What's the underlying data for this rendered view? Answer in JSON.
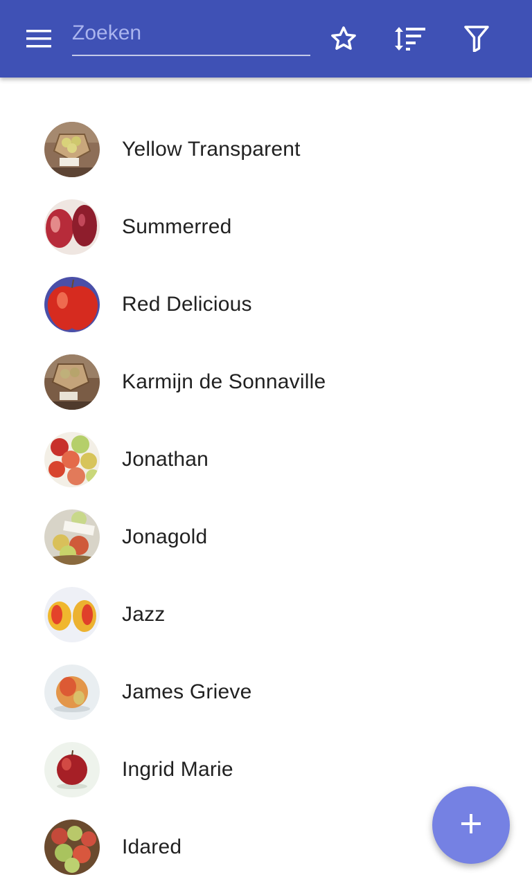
{
  "colors": {
    "appbar": "#3f51b5",
    "fab": "#7581e3",
    "text": "#212121",
    "placeholder": "#aab4ee"
  },
  "appbar": {
    "menu_icon": "hamburger-menu-icon",
    "search": {
      "placeholder": "Zoeken",
      "value": ""
    },
    "actions": [
      {
        "name": "favorites",
        "icon": "star-outline-icon"
      },
      {
        "name": "sort",
        "icon": "sort-icon"
      },
      {
        "name": "filter",
        "icon": "filter-icon"
      }
    ]
  },
  "apples": [
    {
      "name": "Yellow Transparent"
    },
    {
      "name": "Summerred"
    },
    {
      "name": "Red Delicious"
    },
    {
      "name": "Karmijn de Sonnaville"
    },
    {
      "name": "Jonathan"
    },
    {
      "name": "Jonagold"
    },
    {
      "name": "Jazz"
    },
    {
      "name": "James Grieve"
    },
    {
      "name": "Ingrid Marie"
    },
    {
      "name": "Idared"
    }
  ],
  "fab": {
    "icon": "plus-icon"
  }
}
